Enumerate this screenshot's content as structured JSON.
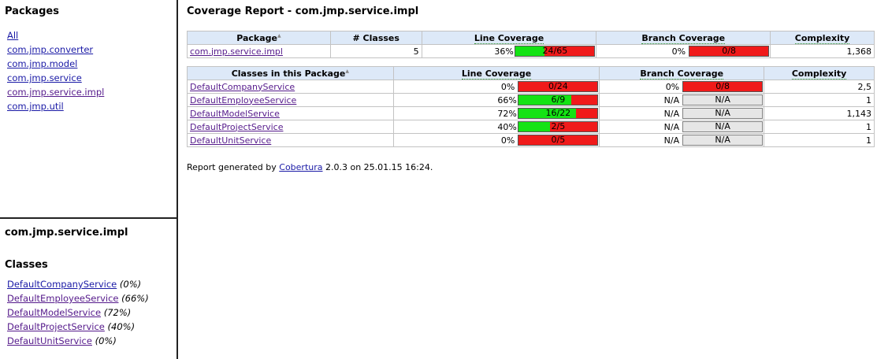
{
  "packages_frame": {
    "title": "Packages",
    "items": [
      "All",
      "com.jmp.converter",
      "com.jmp.model",
      "com.jmp.service",
      "com.jmp.service.impl",
      "com.jmp.util"
    ]
  },
  "classes_frame": {
    "package_title": "com.jmp.service.impl",
    "title": "Classes",
    "items": [
      {
        "name": "DefaultCompanyService",
        "pct": "(0%)"
      },
      {
        "name": "DefaultEmployeeService",
        "pct": "(66%)"
      },
      {
        "name": "DefaultModelService",
        "pct": "(72%)"
      },
      {
        "name": "DefaultProjectService",
        "pct": "(40%)"
      },
      {
        "name": "DefaultUnitService",
        "pct": "(0%)"
      }
    ]
  },
  "main": {
    "title": "Coverage Report - com.jmp.service.impl",
    "package_table": {
      "headers": [
        "Package",
        "# Classes",
        "Line Coverage",
        "Branch Coverage",
        "Complexity"
      ],
      "sort_marker": "▲",
      "row": {
        "package": "com.jmp.service.impl",
        "classes": "5",
        "line_pct": "36%",
        "line_frac": 0.369,
        "line_label": "24/65",
        "branch_pct": "0%",
        "branch_frac": 0,
        "branch_label": "0/8",
        "complexity": "1,368"
      }
    },
    "class_table": {
      "headers": [
        "Classes in this Package",
        "Line Coverage",
        "Branch Coverage",
        "Complexity"
      ],
      "sort_marker": "▲",
      "rows": [
        {
          "name": "DefaultCompanyService",
          "line_pct": "0%",
          "line_frac": 0,
          "line_label": "0/24",
          "branch_pct": "0%",
          "branch_frac": 0,
          "branch_label": "0/8",
          "branch_na": false,
          "complexity": "2,5"
        },
        {
          "name": "DefaultEmployeeService",
          "line_pct": "66%",
          "line_frac": 0.667,
          "line_label": "6/9",
          "branch_pct": "N/A",
          "branch_frac": 0,
          "branch_label": "N/A",
          "branch_na": true,
          "complexity": "1"
        },
        {
          "name": "DefaultModelService",
          "line_pct": "72%",
          "line_frac": 0.727,
          "line_label": "16/22",
          "branch_pct": "N/A",
          "branch_frac": 0,
          "branch_label": "N/A",
          "branch_na": true,
          "complexity": "1,143"
        },
        {
          "name": "DefaultProjectService",
          "line_pct": "40%",
          "line_frac": 0.4,
          "line_label": "2/5",
          "branch_pct": "N/A",
          "branch_frac": 0,
          "branch_label": "N/A",
          "branch_na": true,
          "complexity": "1"
        },
        {
          "name": "DefaultUnitService",
          "line_pct": "0%",
          "line_frac": 0,
          "line_label": "0/5",
          "branch_pct": "N/A",
          "branch_frac": 0,
          "branch_label": "N/A",
          "branch_na": true,
          "complexity": "1"
        }
      ]
    },
    "footer": {
      "prefix": "Report generated by ",
      "link": "Cobertura",
      "suffix": " 2.0.3 on 25.01.15 16:24."
    }
  },
  "colors": {
    "covered": "#14e314",
    "uncovered": "#f01a1a",
    "na": "#e6e6e6",
    "header_bg": "#dde9f8"
  }
}
